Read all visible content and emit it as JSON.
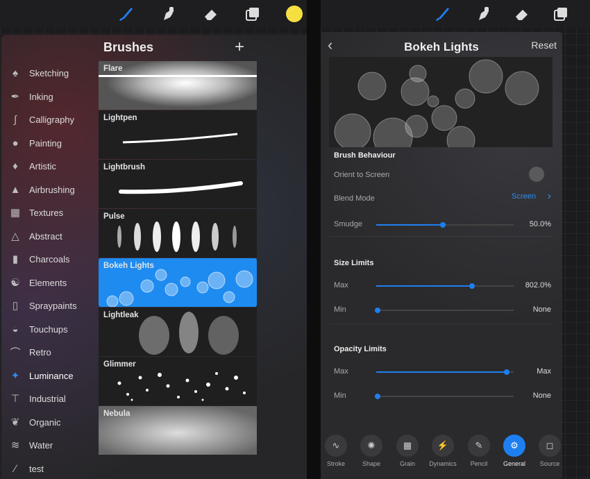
{
  "colors": {
    "accent": "#1e7ff0",
    "selected_brush_bg": "#1e8bf0",
    "color_swatch": "#f5e042"
  },
  "left": {
    "toolbar": [
      "brush-icon",
      "smudge-icon",
      "eraser-icon",
      "layers-icon",
      "color-swatch"
    ],
    "library_title": "Brushes",
    "add_label": "+",
    "categories": [
      {
        "label": "Sketching",
        "icon": "pencil-tip-icon"
      },
      {
        "label": "Inking",
        "icon": "pen-nib-icon"
      },
      {
        "label": "Calligraphy",
        "icon": "calligraphy-icon"
      },
      {
        "label": "Painting",
        "icon": "paint-drop-icon"
      },
      {
        "label": "Artistic",
        "icon": "flame-brush-icon"
      },
      {
        "label": "Airbrushing",
        "icon": "airbrush-icon"
      },
      {
        "label": "Textures",
        "icon": "checker-icon"
      },
      {
        "label": "Abstract",
        "icon": "triangle-icon"
      },
      {
        "label": "Charcoals",
        "icon": "charcoal-icon"
      },
      {
        "label": "Elements",
        "icon": "yin-yang-icon"
      },
      {
        "label": "Spraypaints",
        "icon": "spray-can-icon"
      },
      {
        "label": "Touchups",
        "icon": "touchup-icon"
      },
      {
        "label": "Retro",
        "icon": "retro-icon"
      },
      {
        "label": "Luminance",
        "icon": "sparkle-icon"
      },
      {
        "label": "Industrial",
        "icon": "anvil-icon"
      },
      {
        "label": "Organic",
        "icon": "leaf-icon"
      },
      {
        "label": "Water",
        "icon": "waves-icon"
      },
      {
        "label": "test",
        "icon": "stroke-icon"
      }
    ],
    "active_category": "Luminance",
    "brushes": [
      {
        "name": "Flare"
      },
      {
        "name": "Lightpen"
      },
      {
        "name": "Lightbrush"
      },
      {
        "name": "Pulse"
      },
      {
        "name": "Bokeh Lights"
      },
      {
        "name": "Lightleak"
      },
      {
        "name": "Glimmer"
      },
      {
        "name": "Nebula"
      }
    ],
    "selected_brush": "Bokeh Lights"
  },
  "right": {
    "toolbar": [
      "brush-icon",
      "smudge-icon",
      "eraser-icon",
      "layers-icon"
    ],
    "title": "Bokeh Lights",
    "reset_label": "Reset",
    "brush_behaviour": {
      "title": "Brush Behaviour",
      "orient_label": "Orient to Screen",
      "blend_label": "Blend Mode",
      "blend_value": "Screen",
      "smudge_label": "Smudge",
      "smudge_value": "50.0%",
      "smudge_level": 0.5
    },
    "size_limits": {
      "title": "Size Limits",
      "max_label": "Max",
      "max_value": "802.0%",
      "max_level": 0.7,
      "min_label": "Min",
      "min_value": "None",
      "min_level": 0.01
    },
    "opacity_limits": {
      "title": "Opacity Limits",
      "max_label": "Max",
      "max_value": "Max",
      "max_level": 0.95,
      "min_label": "Min",
      "min_value": "None",
      "min_level": 0.01
    },
    "tabs": [
      "Stroke",
      "Shape",
      "Grain",
      "Dynamics",
      "Pencil",
      "General",
      "Source"
    ],
    "selected_tab": "General"
  }
}
